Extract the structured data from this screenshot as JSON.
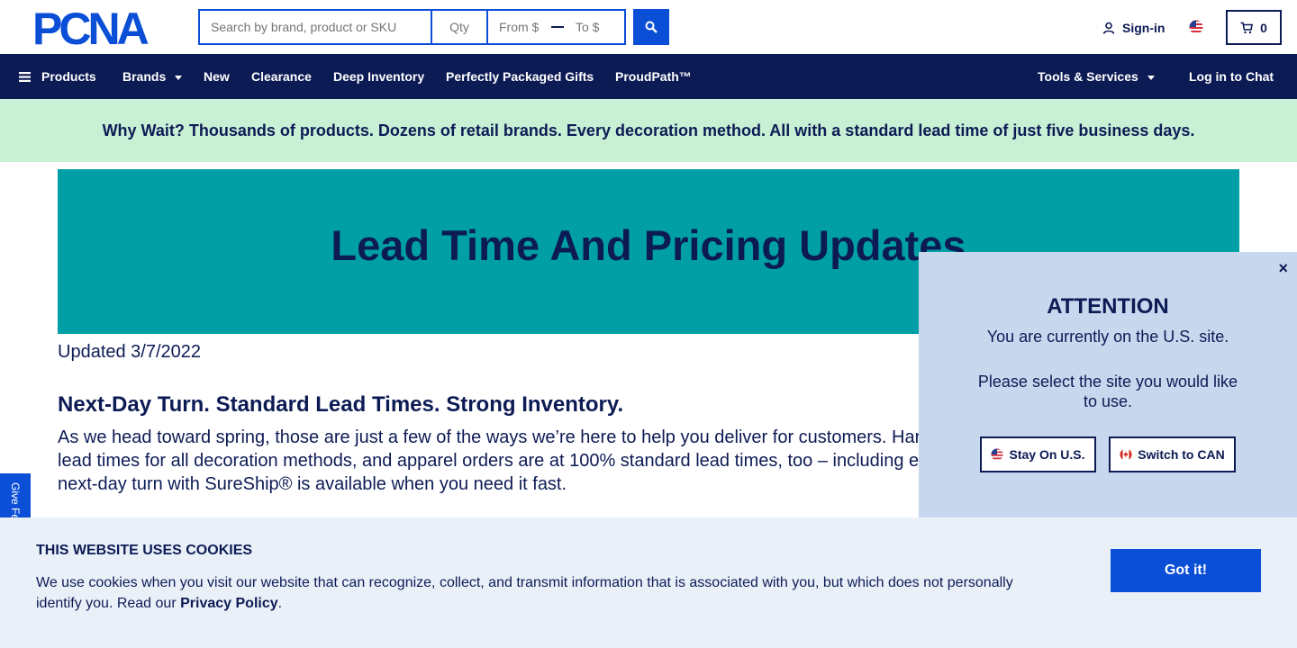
{
  "header": {
    "logo_text": "PCNA",
    "search": {
      "placeholder": "Search by brand, product or SKU",
      "value": ""
    },
    "qty": {
      "placeholder": "Qty",
      "value": ""
    },
    "price_from": {
      "placeholder": "From $",
      "value": ""
    },
    "price_to": {
      "placeholder": "To $",
      "value": ""
    },
    "signin_label": "Sign-in",
    "cart_count": "0",
    "icons": {
      "search": "search-icon",
      "user": "user-icon",
      "flag": "us-flag-icon",
      "cart": "cart-icon"
    }
  },
  "nav": {
    "products": "Products",
    "brands": "Brands",
    "new": "New",
    "clearance": "Clearance",
    "deep_inventory": "Deep Inventory",
    "gifts": "Perfectly Packaged Gifts",
    "proudpath": "ProudPath™",
    "tools": "Tools & Services",
    "chat": "Log in to Chat"
  },
  "promo": {
    "text": "Why Wait? Thousands of products. Dozens of retail brands. Every decoration method. All with a standard lead time of just five business days."
  },
  "main": {
    "hero_title": "Lead Time And Pricing Updates",
    "updated": "Updated 3/7/2022",
    "section_heading": "Next-Day Turn. Standard Lead Times. Strong Inventory.",
    "body_line1": "As we head toward spring, those are just a few of the ways we’re here to help you deliver for customers. Har",
    "body_line2": "lead times for all decoration methods, and apparel orders are at 100% standard lead times, too – including e",
    "body_line3": "next-day turn with SureShip® is available when you need it fast."
  },
  "feedback": {
    "label": "Give Fe"
  },
  "attention": {
    "close": "×",
    "title": "ATTENTION",
    "line1": "You are currently on the U.S. site.",
    "line2": "Please select the site you would like to use.",
    "stay_button": "Stay On U.S.",
    "switch_button": "Switch to CAN"
  },
  "cookie": {
    "title": "THIS WEBSITE USES COOKIES",
    "text": "We use cookies when you visit our website that can recognize, collect, and transmit information that is associated with you, but which does not personally identify you. Read our",
    "link": "Privacy Policy",
    "period": ".",
    "button": "Got it!"
  },
  "colors": {
    "navy": "#0d1b55",
    "blue": "#0b4fd6",
    "teal": "#009fa6",
    "mint": "#c8f0d4",
    "popup": "#c7d7ee",
    "cookie_bg": "#eaf0f8"
  }
}
